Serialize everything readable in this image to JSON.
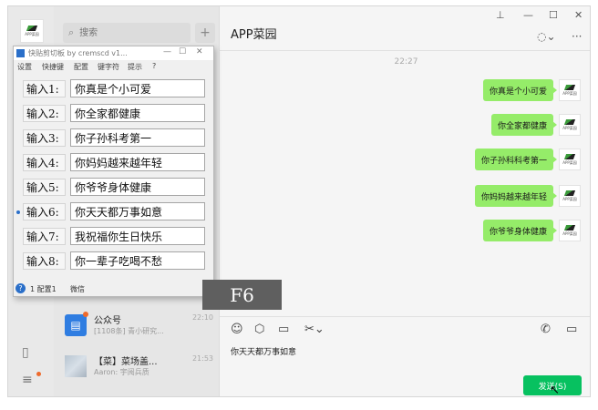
{
  "search": {
    "placeholder": "搜索"
  },
  "chat": {
    "title": "APP菜园",
    "timestamp": "22:27",
    "messages": [
      "你真是个小可爱",
      "你全家都健康",
      "你子孙科科考第一",
      "你妈妈越来越年轻",
      "你爷爷身体健康"
    ],
    "input_text": "你天天都万事如意",
    "send_label": "发送(S)"
  },
  "avatar_text": "APP菜园",
  "conversations": [
    {
      "name": "公众号",
      "time": "22:10",
      "preview": "[1108条] 青小研究..."
    },
    {
      "name": "【菜】菜场盖...",
      "time": "21:53",
      "preview": "Aaron: 宇阅兵质"
    }
  ],
  "quick_tool": {
    "title": "快贴剪切板 by cremscd v1...",
    "menu": [
      "设置",
      "快捷键",
      "配置",
      "键字符",
      "提示",
      "?"
    ],
    "rows": [
      {
        "label": "输入1:",
        "value": "你真是个小可爱"
      },
      {
        "label": "输入2:",
        "value": "你全家都健康"
      },
      {
        "label": "输入3:",
        "value": "你子孙科考第一"
      },
      {
        "label": "输入4:",
        "value": "你妈妈越来越年轻"
      },
      {
        "label": "输入5:",
        "value": "你爷爷身体健康"
      },
      {
        "label": "输入6:",
        "value": "你天天都万事如意"
      },
      {
        "label": "输入7:",
        "value": "我祝福你生日快乐"
      },
      {
        "label": "输入8:",
        "value": "你一辈子吃喝不愁"
      }
    ],
    "status_config": "1 配置1",
    "status_target": "微信"
  },
  "key_overlay": "F6",
  "colors": {
    "bubble": "#95ec69",
    "send": "#07c160",
    "accent": "#2a6fc9"
  }
}
